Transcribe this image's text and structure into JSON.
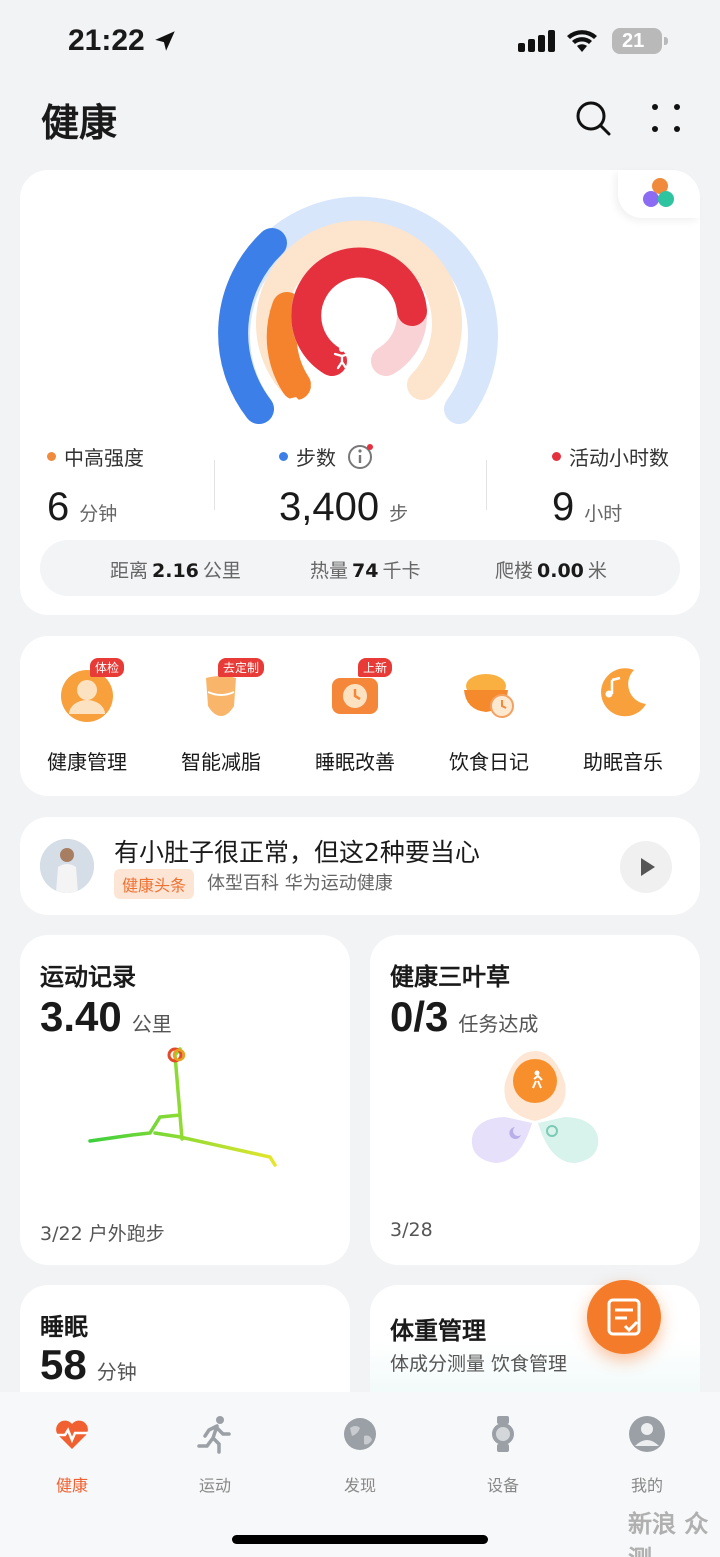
{
  "status_bar": {
    "time": "21:22",
    "battery": "21"
  },
  "header": {
    "title": "健康"
  },
  "activity": {
    "metrics": [
      {
        "label": "中高强度",
        "value": "6",
        "unit": "分钟",
        "color": "#f08a3c"
      },
      {
        "label": "步数",
        "value": "3,400",
        "unit": "步",
        "color": "#3d7fe8"
      },
      {
        "label": "活动小时数",
        "value": "9",
        "unit": "小时",
        "color": "#e5303e"
      }
    ],
    "stats": [
      {
        "label": "距离",
        "value": "2.16",
        "unit": "公里"
      },
      {
        "label": "热量",
        "value": "74",
        "unit": "千卡"
      },
      {
        "label": "爬楼",
        "value": "0.00",
        "unit": "米"
      }
    ],
    "ring_progress": {
      "steps": 0.33,
      "intensity": 0.2,
      "active_hours": 0.75
    }
  },
  "quick_actions": [
    {
      "label": "健康管理",
      "tag": "体检",
      "icon": "health-check-icon"
    },
    {
      "label": "智能减脂",
      "tag": "去定制",
      "icon": "fat-loss-icon"
    },
    {
      "label": "睡眠改善",
      "tag": "上新",
      "icon": "sleep-clock-icon"
    },
    {
      "label": "饮食日记",
      "tag": "",
      "icon": "food-bowl-icon"
    },
    {
      "label": "助眠音乐",
      "tag": "",
      "icon": "moon-music-icon"
    }
  ],
  "news": {
    "title": "有小肚子很正常，但这2种要当心",
    "chip": "健康头条",
    "source": "体型百科 华为运动健康"
  },
  "exercise": {
    "title": "运动记录",
    "value": "3.40",
    "unit": "公里",
    "footer": "3/22 户外跑步"
  },
  "clover": {
    "title": "健康三叶草",
    "value": "0/3",
    "unit": "任务达成",
    "footer": "3/28"
  },
  "sleep": {
    "title": "睡眠",
    "value": "58",
    "unit": "分钟"
  },
  "weight": {
    "title": "体重管理",
    "subtitle": "体成分测量 饮食管理"
  },
  "tabs": [
    {
      "label": "健康",
      "icon": "heart-icon",
      "active": true
    },
    {
      "label": "运动",
      "icon": "runner-icon",
      "active": false
    },
    {
      "label": "发现",
      "icon": "globe-icon",
      "active": false
    },
    {
      "label": "设备",
      "icon": "watch-icon",
      "active": false
    },
    {
      "label": "我的",
      "icon": "profile-icon",
      "active": false
    }
  ],
  "watermark": "新浪 众测",
  "colors": {
    "accent": "#f06030",
    "steps": "#3d7fe8",
    "intensity": "#f08a3c",
    "active": "#e5303e"
  }
}
